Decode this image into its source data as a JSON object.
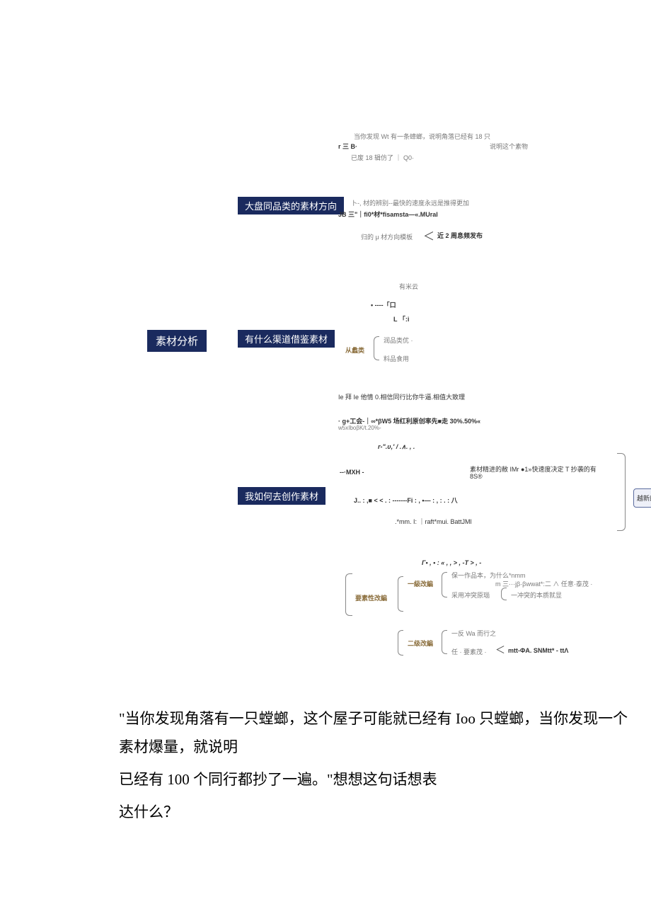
{
  "top": {
    "line1": "当你发现 Wt 有一条蟑螂，说明角落已经有 18 只",
    "line2a": "r 三 B·",
    "line2b": "说明这个素物",
    "line3": "已废 18 辑仿了 ｜ Q0·"
  },
  "root": "素材分析",
  "branch1": {
    "label": "大盘同品类的素材方向",
    "t1": "卜-, 材的辨别--最快的速度永远是推得更加",
    "t2": "JB 三\"｜fi0*材*fisamsta—«.MUral",
    "t3": "归的 μ 材方向模板",
    "t4": "近 2 周息频发布"
  },
  "branch2": {
    "label": "有什么渠道借鉴素材",
    "t_youmi": "有米云",
    "t_dots": "• ----「口",
    "t_li": "L 「:i",
    "from_cat": "从蠡类",
    "cat1": "润品类优 ·",
    "cat2": "料品食用",
    "t_believe": "Ie 拜 Ie 他情 0.相信同行比你牛逼.相值大致理",
    "t_work": "· g+工会-｜∞*βW5 场红利原创率先■走 30%.50%«",
    "t_beta": "w5xIboβK/t.20%-"
  },
  "branch3": {
    "label": "我如何去创作素材",
    "ru": "r-\".υ,' / .∧. , .",
    "mxh": "--·MXH -",
    "j_line": "J.. : ,■ < < . :  -------Fi : , •— :  ,  : . : 八",
    "mm": ".*mm. I:  ｜raft*mui. BattJMl",
    "refine": "素材精进的敝 IMr ●1»快速度决定 T 抄袭的有",
    "eightS": "8S®"
  },
  "bottom": {
    "tser": "Γ• , • : « ,  ,  > , -T > , -",
    "need_adapt": "要素性改編",
    "lvl1": "一級改編",
    "lvl1a": "保一作品本，为什么*nmm",
    "lvl1b": "m 三···jβ·βwwat*:二 ∧ 任意·泰茂 ·",
    "lvl1c": "采用冲突原瑙",
    "lvl1d": "一冲突的本质就显",
    "lvl2": "二级改編",
    "lvl2a": "一反 Wa 而行之",
    "lvl2b": "任 · 要素茂 ·",
    "lvl2c": "mtt-ΦA. SNMtt* - ttΛ"
  },
  "right_label": "越新的素材",
  "quote": {
    "p1": "\"当你发现角落有一只螳螂，这个屋子可能就已经有 Ioo 只螳螂，当你发现一个素材爆量，就说明",
    "p2": "已经有 100 个同行都抄了一遍。\"想想这句话想表",
    "p3": "达什么？"
  },
  "chart_data": {
    "type": "mindmap",
    "root": "素材分析",
    "branches": [
      {
        "label": "大盘同品类的素材方向",
        "children": [
          "材的辨别--最快的速度永远是推得更加",
          "归的 μ 材方向模板",
          "近 2 周息频发布"
        ]
      },
      {
        "label": "有什么渠道借鉴素材",
        "children": [
          "有米云",
          "从蠡类 → 润品类优 / 料品食用",
          "相信同行比你牛逼.相值大致理",
          "g+工会 场红利原创率先走 30%.50%",
          "βK/t.20%"
        ]
      },
      {
        "label": "我如何去创作素材",
        "children": [
          "MXH",
          "素材精进的敝 快速度决定 抄袭的有 8S",
          "要素性改編 → 一級改編 / 二级改編"
        ]
      }
    ]
  }
}
